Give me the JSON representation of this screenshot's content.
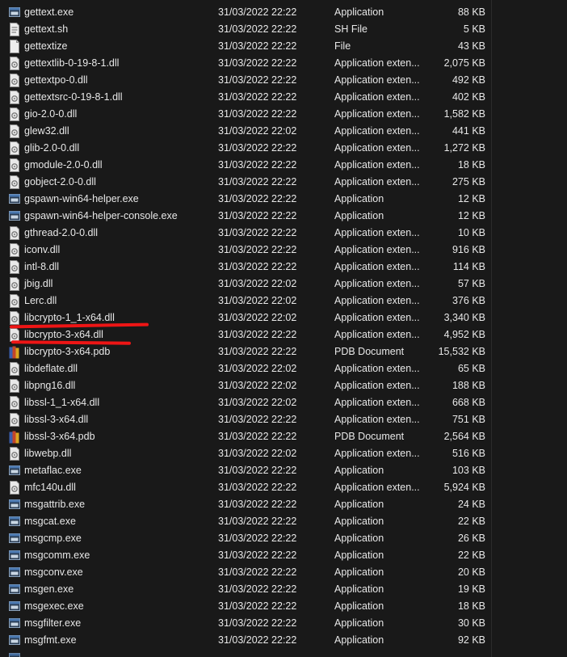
{
  "rows": [
    {
      "name": "gettext.exe",
      "date": "31/03/2022 22:22",
      "type": "Application",
      "size": "88 KB",
      "icon": "exe-icon"
    },
    {
      "name": "gettext.sh",
      "date": "31/03/2022 22:22",
      "type": "SH File",
      "size": "5 KB",
      "icon": "script-file-icon"
    },
    {
      "name": "gettextize",
      "date": "31/03/2022 22:22",
      "type": "File",
      "size": "43 KB",
      "icon": "blank-file-icon"
    },
    {
      "name": "gettextlib-0-19-8-1.dll",
      "date": "31/03/2022 22:22",
      "type": "Application exten...",
      "size": "2,075 KB",
      "icon": "dll-icon"
    },
    {
      "name": "gettextpo-0.dll",
      "date": "31/03/2022 22:22",
      "type": "Application exten...",
      "size": "492 KB",
      "icon": "dll-icon"
    },
    {
      "name": "gettextsrc-0-19-8-1.dll",
      "date": "31/03/2022 22:22",
      "type": "Application exten...",
      "size": "402 KB",
      "icon": "dll-icon"
    },
    {
      "name": "gio-2.0-0.dll",
      "date": "31/03/2022 22:22",
      "type": "Application exten...",
      "size": "1,582 KB",
      "icon": "dll-icon"
    },
    {
      "name": "glew32.dll",
      "date": "31/03/2022 22:02",
      "type": "Application exten...",
      "size": "441 KB",
      "icon": "dll-icon"
    },
    {
      "name": "glib-2.0-0.dll",
      "date": "31/03/2022 22:22",
      "type": "Application exten...",
      "size": "1,272 KB",
      "icon": "dll-icon"
    },
    {
      "name": "gmodule-2.0-0.dll",
      "date": "31/03/2022 22:22",
      "type": "Application exten...",
      "size": "18 KB",
      "icon": "dll-icon"
    },
    {
      "name": "gobject-2.0-0.dll",
      "date": "31/03/2022 22:22",
      "type": "Application exten...",
      "size": "275 KB",
      "icon": "dll-icon"
    },
    {
      "name": "gspawn-win64-helper.exe",
      "date": "31/03/2022 22:22",
      "type": "Application",
      "size": "12 KB",
      "icon": "exe-icon"
    },
    {
      "name": "gspawn-win64-helper-console.exe",
      "date": "31/03/2022 22:22",
      "type": "Application",
      "size": "12 KB",
      "icon": "exe-icon"
    },
    {
      "name": "gthread-2.0-0.dll",
      "date": "31/03/2022 22:22",
      "type": "Application exten...",
      "size": "10 KB",
      "icon": "dll-icon"
    },
    {
      "name": "iconv.dll",
      "date": "31/03/2022 22:22",
      "type": "Application exten...",
      "size": "916 KB",
      "icon": "dll-icon"
    },
    {
      "name": "intl-8.dll",
      "date": "31/03/2022 22:22",
      "type": "Application exten...",
      "size": "114 KB",
      "icon": "dll-icon"
    },
    {
      "name": "jbig.dll",
      "date": "31/03/2022 22:02",
      "type": "Application exten...",
      "size": "57 KB",
      "icon": "dll-icon"
    },
    {
      "name": "Lerc.dll",
      "date": "31/03/2022 22:02",
      "type": "Application exten...",
      "size": "376 KB",
      "icon": "dll-icon"
    },
    {
      "name": "libcrypto-1_1-x64.dll",
      "date": "31/03/2022 22:02",
      "type": "Application exten...",
      "size": "3,340 KB",
      "icon": "dll-icon"
    },
    {
      "name": "libcrypto-3-x64.dll",
      "date": "31/03/2022 22:22",
      "type": "Application exten...",
      "size": "4,952 KB",
      "icon": "dll-icon"
    },
    {
      "name": "libcrypto-3-x64.pdb",
      "date": "31/03/2022 22:22",
      "type": "PDB Document",
      "size": "15,532 KB",
      "icon": "pdb-icon"
    },
    {
      "name": "libdeflate.dll",
      "date": "31/03/2022 22:02",
      "type": "Application exten...",
      "size": "65 KB",
      "icon": "dll-icon"
    },
    {
      "name": "libpng16.dll",
      "date": "31/03/2022 22:02",
      "type": "Application exten...",
      "size": "188 KB",
      "icon": "dll-icon"
    },
    {
      "name": "libssl-1_1-x64.dll",
      "date": "31/03/2022 22:02",
      "type": "Application exten...",
      "size": "668 KB",
      "icon": "dll-icon"
    },
    {
      "name": "libssl-3-x64.dll",
      "date": "31/03/2022 22:22",
      "type": "Application exten...",
      "size": "751 KB",
      "icon": "dll-icon"
    },
    {
      "name": "libssl-3-x64.pdb",
      "date": "31/03/2022 22:22",
      "type": "PDB Document",
      "size": "2,564 KB",
      "icon": "pdb-icon"
    },
    {
      "name": "libwebp.dll",
      "date": "31/03/2022 22:02",
      "type": "Application exten...",
      "size": "516 KB",
      "icon": "dll-icon"
    },
    {
      "name": "metaflac.exe",
      "date": "31/03/2022 22:22",
      "type": "Application",
      "size": "103 KB",
      "icon": "exe-icon"
    },
    {
      "name": "mfc140u.dll",
      "date": "31/03/2022 22:22",
      "type": "Application exten...",
      "size": "5,924 KB",
      "icon": "dll-icon"
    },
    {
      "name": "msgattrib.exe",
      "date": "31/03/2022 22:22",
      "type": "Application",
      "size": "24 KB",
      "icon": "exe-icon"
    },
    {
      "name": "msgcat.exe",
      "date": "31/03/2022 22:22",
      "type": "Application",
      "size": "22 KB",
      "icon": "exe-icon"
    },
    {
      "name": "msgcmp.exe",
      "date": "31/03/2022 22:22",
      "type": "Application",
      "size": "26 KB",
      "icon": "exe-icon"
    },
    {
      "name": "msgcomm.exe",
      "date": "31/03/2022 22:22",
      "type": "Application",
      "size": "22 KB",
      "icon": "exe-icon"
    },
    {
      "name": "msgconv.exe",
      "date": "31/03/2022 22:22",
      "type": "Application",
      "size": "20 KB",
      "icon": "exe-icon"
    },
    {
      "name": "msgen.exe",
      "date": "31/03/2022 22:22",
      "type": "Application",
      "size": "19 KB",
      "icon": "exe-icon"
    },
    {
      "name": "msgexec.exe",
      "date": "31/03/2022 22:22",
      "type": "Application",
      "size": "18 KB",
      "icon": "exe-icon"
    },
    {
      "name": "msgfilter.exe",
      "date": "31/03/2022 22:22",
      "type": "Application",
      "size": "30 KB",
      "icon": "exe-icon"
    },
    {
      "name": "msgfmt.exe",
      "date": "31/03/2022 22:22",
      "type": "Application",
      "size": "92 KB",
      "icon": "exe-icon"
    }
  ],
  "annotation_color": "#ee1515",
  "colors": {
    "background": "#191919",
    "text": "#e8e8e8",
    "divider": "#2b2b2b"
  }
}
